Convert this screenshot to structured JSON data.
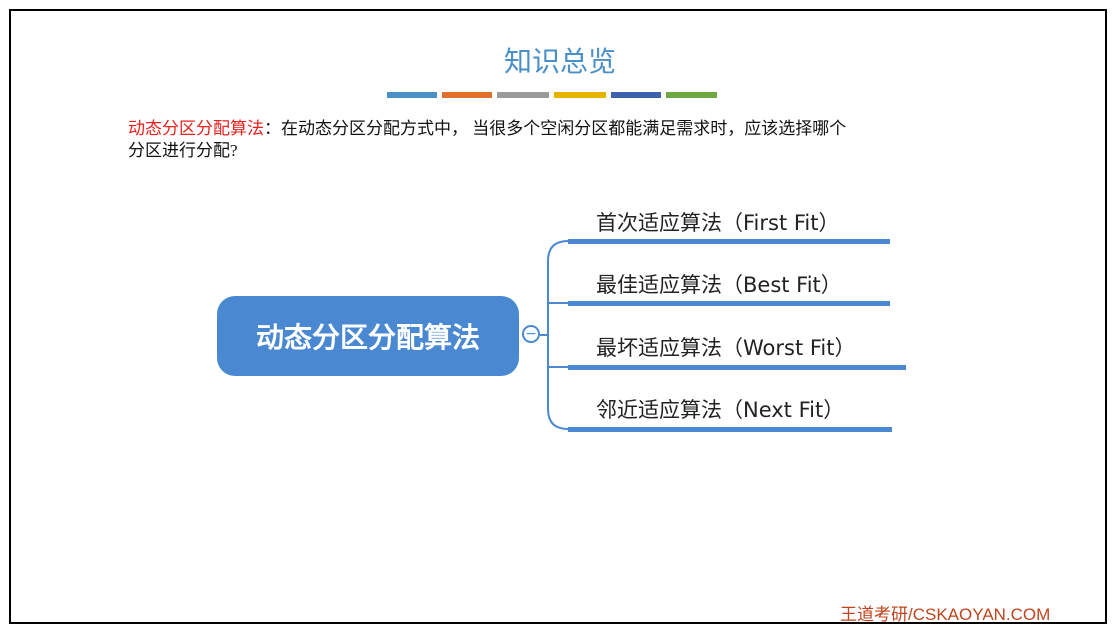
{
  "title": "知识总览",
  "color_bars": [
    {
      "color": "#4a90c8"
    },
    {
      "color": "#e0702b"
    },
    {
      "color": "#9a9a9a"
    },
    {
      "color": "#e8b200"
    },
    {
      "color": "#3c62ad"
    },
    {
      "color": "#6ea840"
    }
  ],
  "intro": {
    "highlight": "动态分区分配算法",
    "text_line1": "：在动态分区分配方式中， 当很多个空闲分区都能满足需求时，应该选择哪个",
    "text_line2": "分区进行分配?"
  },
  "mindmap": {
    "root": "动态分区分配算法",
    "collapse_symbol": "−",
    "branches": [
      {
        "label": "首次适应算法（First Fit）"
      },
      {
        "label": "最佳适应算法（Best Fit）"
      },
      {
        "label": "最坏适应算法（Worst Fit）"
      },
      {
        "label": "邻近适应算法（Next Fit）"
      }
    ],
    "branch_color": "#4a89d1"
  },
  "footer": "王道考研/CSKAOYAN.COM"
}
